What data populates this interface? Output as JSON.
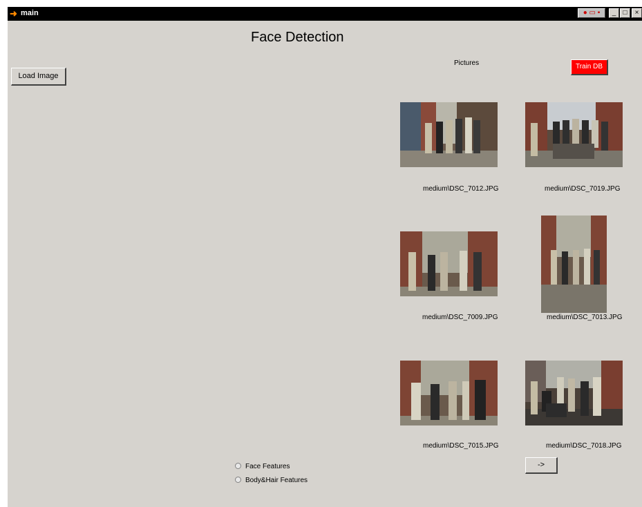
{
  "window": {
    "title": "main"
  },
  "heading": "Face Detection",
  "load_button": "Load Image",
  "pictures_label": "Pictures",
  "train_button": "Train DB",
  "next_button": "->",
  "thumbnails": [
    {
      "caption": "medium\\DSC_7012.JPG"
    },
    {
      "caption": "medium\\DSC_7019.JPG"
    },
    {
      "caption": "medium\\DSC_7009.JPG"
    },
    {
      "caption": "medium\\DSC_7013.JPG"
    },
    {
      "caption": "medium\\DSC_7015.JPG"
    },
    {
      "caption": "medium\\DSC_7018.JPG"
    }
  ],
  "options": [
    {
      "label": "Face Features",
      "selected": false
    },
    {
      "label": "Body&Hair Features",
      "selected": false
    }
  ],
  "colors": {
    "train_button": "#ff0000",
    "window_bg": "#d6d3ce",
    "titlebar": "#000000"
  }
}
